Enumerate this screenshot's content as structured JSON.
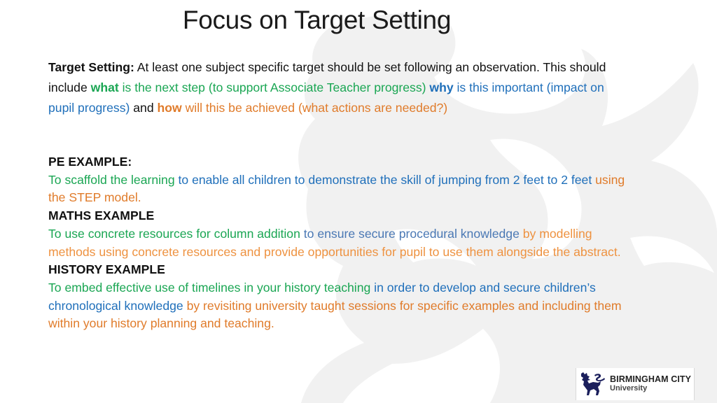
{
  "slide": {
    "title": "Focus on Target Setting",
    "intro": {
      "label": "Target Setting:",
      "text1": " At least one subject specific target should be set following an observation. This should include ",
      "what_keyword": "what",
      "what_text": " is the next step (to support Associate Teacher progress) ",
      "why_keyword": "why",
      "why_text": " is this important (impact on pupil progress)",
      "and_text": " and ",
      "how_keyword": "how",
      "how_text": " will this be achieved (what actions are needed?)"
    },
    "examples": [
      {
        "heading": "PE EXAMPLE:",
        "what": "To scaffold the learning",
        "why": " to enable all children to demonstrate the skill of jumping from 2 feet to 2 feet",
        "how": " using the STEP model."
      },
      {
        "heading": "MATHS EXAMPLE",
        "what": "To use concrete resources for column addition",
        "why": " to ensure secure procedural knowledge",
        "how": " by modelling methods using concrete resources and provide opportunities for pupil to use them alongside the abstract."
      },
      {
        "heading": "HISTORY EXAMPLE",
        "what": "To embed effective use of timelines in your history teaching",
        "why": " in order to develop and secure children’s chronological knowledge",
        "how": " by revisiting university taught sessions for specific examples and including them within your history planning and teaching."
      }
    ],
    "colors": {
      "what": "#1aa653",
      "why": "#1f6fba",
      "how": "#e07b2a"
    }
  },
  "logo": {
    "icon": "lion-rampant-icon",
    "line1": "BIRMINGHAM CITY",
    "line2": "University"
  }
}
